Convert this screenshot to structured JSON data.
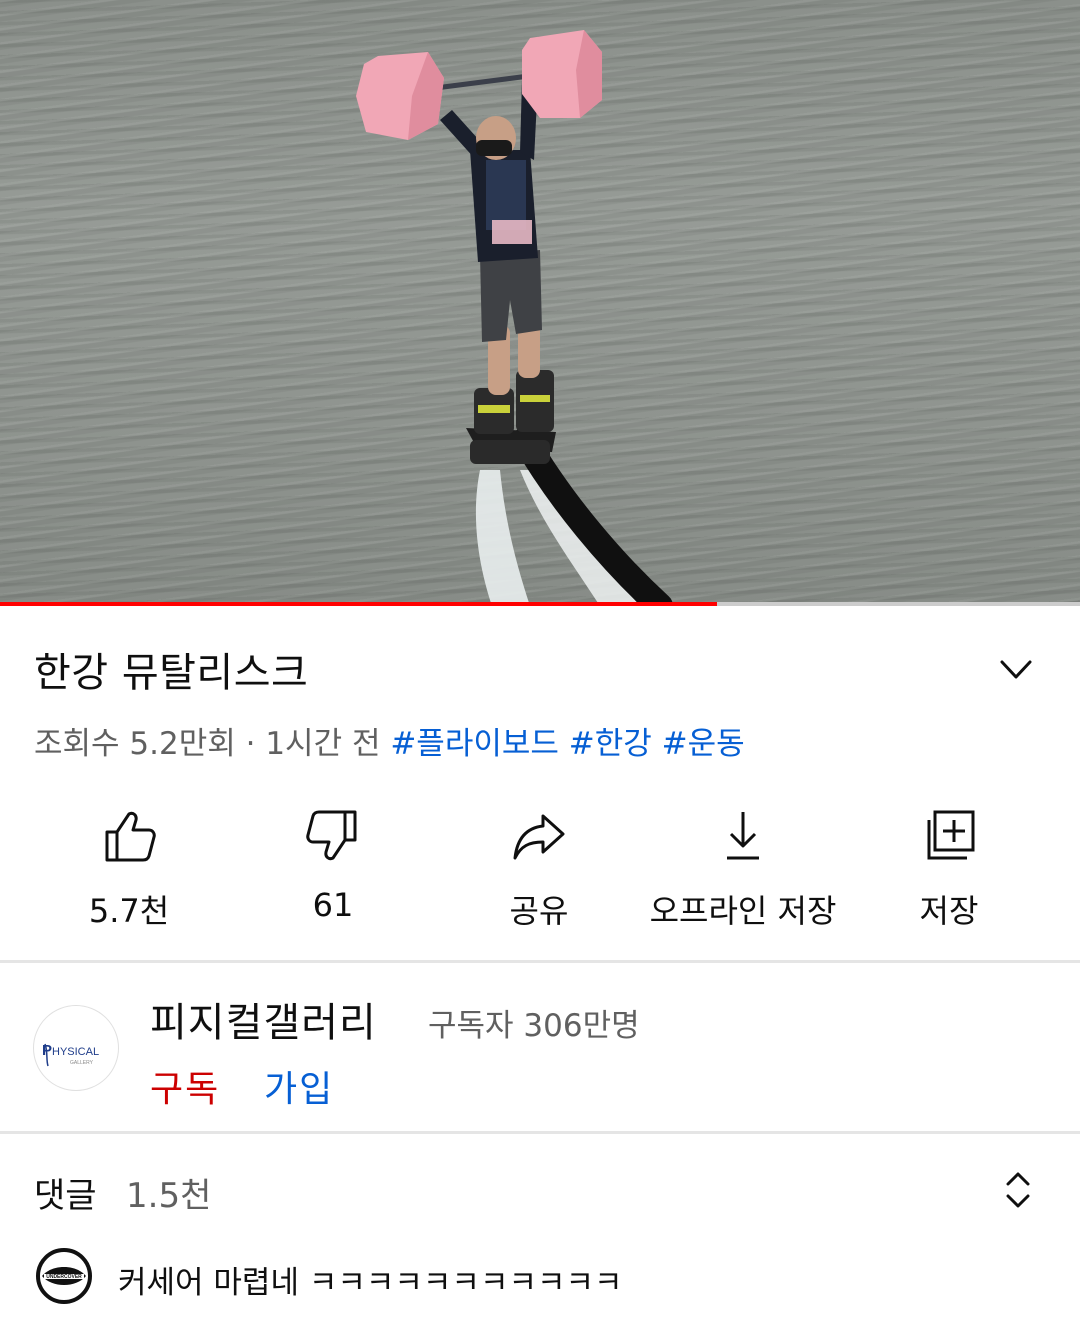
{
  "video": {
    "progress_fraction": 0.664,
    "colors": {
      "progress": "#ff0000",
      "track": "#cccccc"
    }
  },
  "title": "한강 뮤탈리스크",
  "meta": {
    "views": "조회수 5.2만회",
    "separator": " · ",
    "uploaded": "1시간 전",
    "hashtags": [
      "#플라이보드",
      "#한강",
      "#운동"
    ],
    "hashtag_color": "#065fd4"
  },
  "actions": [
    {
      "icon": "thumbs-up-icon",
      "label": "5.7천"
    },
    {
      "icon": "thumbs-down-icon",
      "label": "61"
    },
    {
      "icon": "share-icon",
      "label": "공유"
    },
    {
      "icon": "download-icon",
      "label": "오프라인 저장"
    },
    {
      "icon": "save-to-playlist-icon",
      "label": "저장"
    }
  ],
  "channel": {
    "name": "피지컬갤러리",
    "subscribers": "구독자 306만명",
    "subscribe_label": "구독",
    "join_label": "가입",
    "subscribe_color": "#cc0000",
    "avatar_logo": {
      "text": "PHYSICAL",
      "sub": "GALLERY"
    }
  },
  "comments": {
    "label": "댓글",
    "count": "1.5천",
    "top_comment": "커세어 마렵네 ㅋㅋㅋㅋㅋㅋㅋㅋㅋㅋㅋ",
    "avatar_logo": "UNDERCOVER"
  }
}
